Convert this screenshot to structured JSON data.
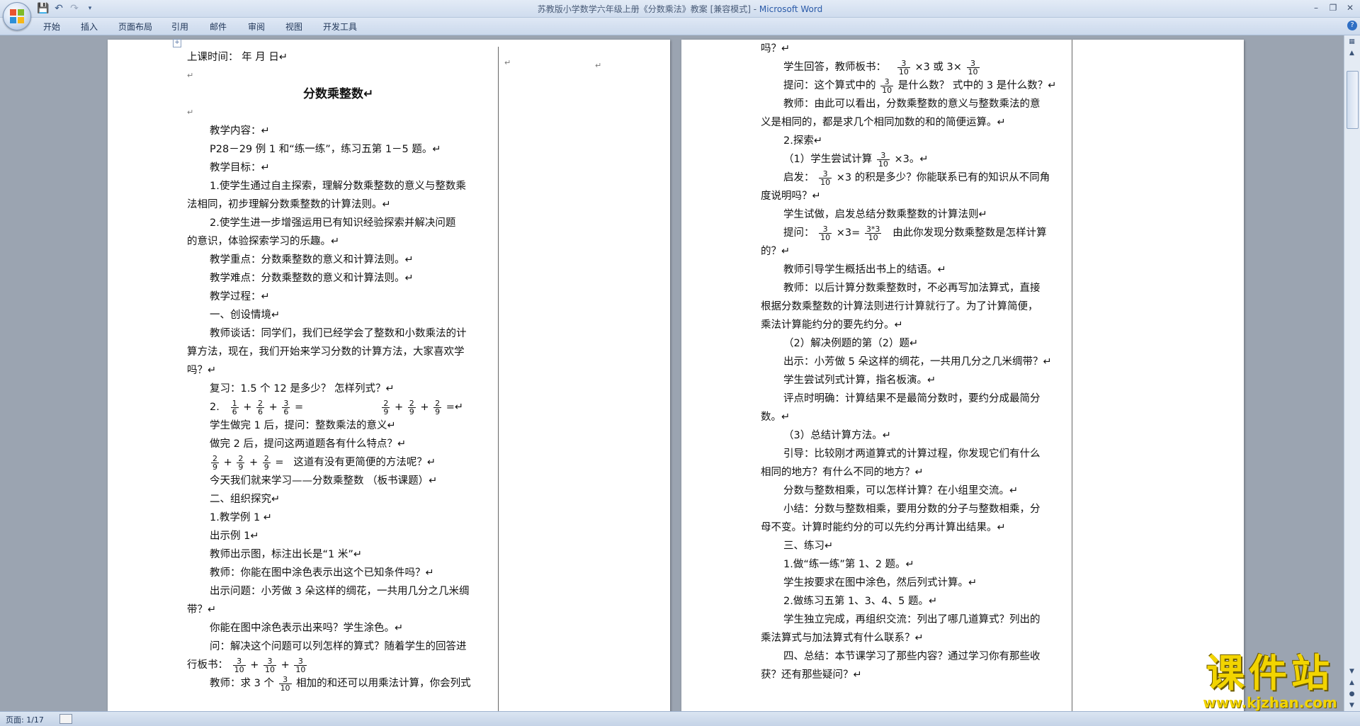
{
  "window": {
    "title": "苏教版小学数学六年级上册《分数乘法》教案 [兼容模式] - ",
    "app_name": "Microsoft Word"
  },
  "tabs": [
    "开始",
    "插入",
    "页面布局",
    "引用",
    "邮件",
    "审阅",
    "视图",
    "开发工具"
  ],
  "status": {
    "page": "页面: 1/17"
  },
  "watermark": {
    "text": "课件站",
    "url": "www.kjzhan.com"
  },
  "page1": {
    "lines": [
      "上课时间：      年    月     日↵",
      "↵",
      "分数乘整数↵",
      "↵",
      "教学内容：↵",
      "P28－29 例 1 和“练一练”，练习五第 1－5 题。↵",
      "教学目标：↵",
      "1.使学生通过自主探索，理解分数乘整数的意义与整数乘",
      "法相同，初步理解分数乘整数的计算法则。↵",
      "2.使学生进一步增强运用已有知识经验探索并解决问题",
      "的意识，体验探索学习的乐趣。↵",
      "教学重点：分数乘整数的意义和计算法则。↵",
      "教学难点：分数乘整数的意义和计算法则。↵",
      "教学过程：↵",
      "一、创设情境↵",
      "教师谈话：同学们，我们已经学会了整数和小数乘法的计",
      "算方法，现在，我们开始来学习分数的计算方法，大家喜欢学",
      "吗？↵",
      "复习：1.5 个 12 是多少？   怎样列式？↵",
      "2.",
      "学生做完 1 后，提问：整数乘法的意义↵",
      "做完 2 后，提问这两道题各有什么特点？↵",
      "这道有没有更简便的方法呢？↵",
      "今天我们就来学习——分数乘整数 （板书课题）↵",
      "二、组织探究↵",
      "1.教学例 1  ↵",
      "出示例 1↵",
      "教师出示图，标注出长是“1 米”↵",
      "教师：你能在图中涂色表示出这个已知条件吗？↵",
      "出示问题：小芳做 3 朵这样的绸花，一共用几分之几米绸",
      "带？↵",
      "你能在图中涂色表示出来吗？学生涂色。↵",
      "问：解决这个问题可以列怎样的算式？随着学生的回答进",
      "行板书：",
      "教师：求 3 个",
      "相加的和还可以用乘法计算，你会列式"
    ],
    "fractions": {
      "r1": [
        "1",
        "6",
        "2",
        "6",
        "3",
        "6"
      ],
      "r2": [
        "2",
        "9",
        "2",
        "9",
        "2",
        "9"
      ],
      "r3": [
        "3",
        "10",
        "3",
        "10",
        "3",
        "10"
      ],
      "r4": [
        "3",
        "10"
      ]
    },
    "ops": {
      "plus": "+",
      "eq": "=",
      "eqend": "=↵"
    }
  },
  "page2": {
    "lines": [
      "吗？↵",
      "学生回答，教师板书：",
      "×3 或 3×",
      "提问：这个算式中的",
      "是什么数？ 式中的 3 是什么数？↵",
      "教师：由此可以看出，分数乘整数的意义与整数乘法的意",
      "义是相同的，都是求几个相同加数的和的简便运算。↵",
      "2.探索↵",
      "（1）学生尝试计算",
      "×3。↵",
      "启发：",
      "×3 的积是多少？你能联系已有的知识从不同角",
      "度说明吗？↵",
      "学生试做，启发总结分数乘整数的计算法则↵",
      "提问：",
      "×3=",
      "由此你发现分数乘整数是怎样计算",
      "的？↵",
      "教师引导学生概括出书上的结语。↵",
      "教师：以后计算分数乘整数时，不必再写加法算式，直接",
      "根据分数乘整数的计算法则进行计算就行了。为了计算简便，",
      "乘法计算能约分的要先约分。↵",
      "（2）解决例题的第（2）题↵",
      "出示：小芳做 5 朵这样的绸花，一共用几分之几米绸带？↵",
      "学生尝试列式计算，指名板演。↵",
      "评点时明确：计算结果不是最简分数时，要约分成最简分",
      "数。↵",
      "（3）总结计算方法。↵",
      "引导：比较刚才两道算式的计算过程，你发现它们有什么",
      "相同的地方？有什么不同的地方？↵",
      "分数与整数相乘，可以怎样计算？在小组里交流。↵",
      "小结：分数与整数相乘，要用分数的分子与整数相乘，分",
      "母不变。计算时能约分的可以先约分再计算出结果。↵",
      "三、练习↵",
      "1.做“练一练”第 1、2 题。↵",
      "学生按要求在图中涂色，然后列式计算。↵",
      "2.做练习五第 1、3、4、5 题。↵",
      "学生独立完成，再组织交流：列出了哪几道算式？列出的",
      "乘法算式与加法算式有什么联系？↵",
      "四、总结：本节课学习了那些内容？通过学习你有那些收",
      "获？还有那些疑问？↵"
    ],
    "fractions": {
      "a": [
        "3",
        "10"
      ],
      "b": [
        "3*3",
        "10"
      ]
    }
  }
}
